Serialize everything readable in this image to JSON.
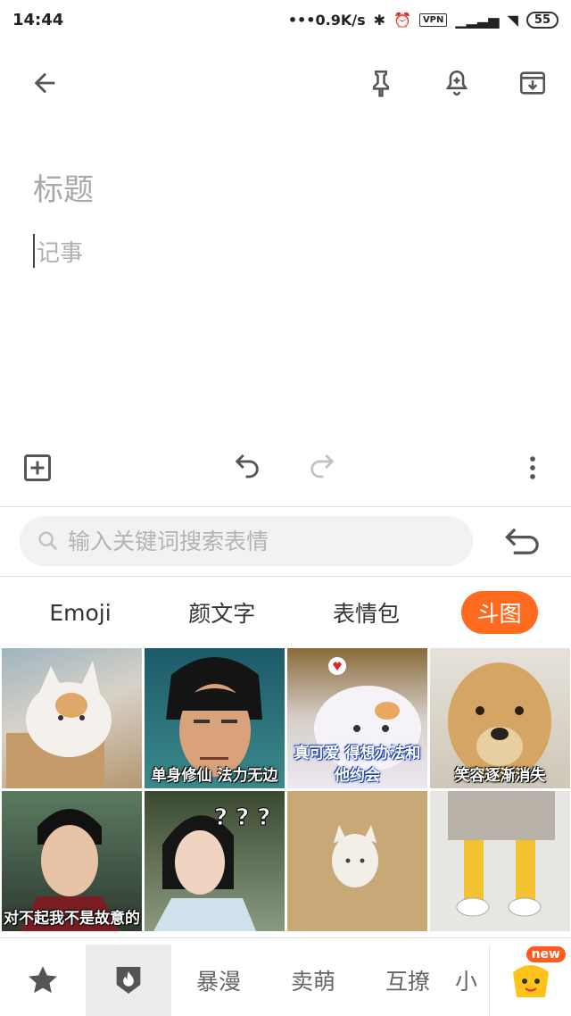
{
  "status": {
    "time": "14:44",
    "speed": "0.9K/s",
    "vpn": "VPN",
    "battery": "55"
  },
  "note": {
    "title_placeholder": "标题",
    "body_placeholder": "记事"
  },
  "keyboard": {
    "search_placeholder": "输入关键词搜索表情",
    "tabs": [
      {
        "label": "Emoji"
      },
      {
        "label": "颜文字"
      },
      {
        "label": "表情包"
      },
      {
        "label": "斗图"
      }
    ],
    "stickers": [
      {
        "caption": ""
      },
      {
        "caption": "单身修仙 法力无边"
      },
      {
        "caption": "真可爱 得想办法和他约会"
      },
      {
        "caption": "笑容逐渐消失"
      },
      {
        "caption": "对不起我不是故意的"
      },
      {
        "caption": ""
      },
      {
        "caption": ""
      },
      {
        "caption": ""
      }
    ],
    "bottom_categories": [
      {
        "label": "暴漫"
      },
      {
        "label": "卖萌"
      },
      {
        "label": "互撩"
      },
      {
        "label": "小"
      }
    ],
    "new_badge": "new"
  },
  "colors": {
    "accent": "#ff6a1f",
    "grey_icon": "#555555"
  }
}
